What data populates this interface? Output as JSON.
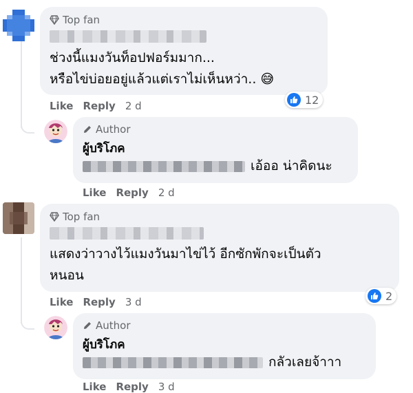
{
  "comments": [
    {
      "badge": "Top fan",
      "text_lines": [
        "ช่วงนี้แมงวันท็อปฟอร์มมาก...",
        "หรือไข่บ่อยอยู่แล้วแต่เราไม่เห็นหว่า.. 😅"
      ],
      "actions": {
        "like": "Like",
        "reply": "Reply",
        "time": "2 d"
      },
      "reactions": "12",
      "reply": {
        "badge": "Author",
        "name": "ผู้บริโภค",
        "text": "เอ้ออ น่าคิดนะ",
        "actions": {
          "like": "Like",
          "reply": "Reply",
          "time": "2 d"
        }
      }
    },
    {
      "badge": "Top fan",
      "text_lines": [
        "แสดงว่าวางไว้แมงวันมาไข่ไว้ อีกซักพักจะเป็นตัว",
        "หนอน"
      ],
      "actions": {
        "like": "Like",
        "reply": "Reply",
        "time": "3 d"
      },
      "reactions": "2",
      "reply": {
        "badge": "Author",
        "name": "ผู้บริโภค",
        "text": "กลัวเลยจ้าาา",
        "actions": {
          "like": "Like",
          "reply": "Reply",
          "time": "3 d"
        }
      }
    }
  ],
  "colors": {
    "bubble": "#f0f2f5",
    "meta": "#65676b",
    "like_blue": "#1877f2",
    "thread_line": "#e4e6eb"
  }
}
